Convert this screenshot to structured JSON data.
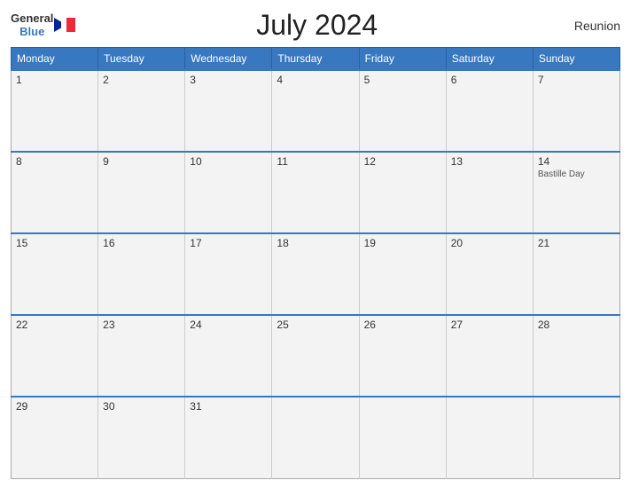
{
  "header": {
    "title": "July 2024",
    "logo_general": "General",
    "logo_blue": "Blue",
    "region": "Reunion"
  },
  "days_of_week": [
    "Monday",
    "Tuesday",
    "Wednesday",
    "Thursday",
    "Friday",
    "Saturday",
    "Sunday"
  ],
  "weeks": [
    [
      {
        "date": "1",
        "event": ""
      },
      {
        "date": "2",
        "event": ""
      },
      {
        "date": "3",
        "event": ""
      },
      {
        "date": "4",
        "event": ""
      },
      {
        "date": "5",
        "event": ""
      },
      {
        "date": "6",
        "event": ""
      },
      {
        "date": "7",
        "event": ""
      }
    ],
    [
      {
        "date": "8",
        "event": ""
      },
      {
        "date": "9",
        "event": ""
      },
      {
        "date": "10",
        "event": ""
      },
      {
        "date": "11",
        "event": ""
      },
      {
        "date": "12",
        "event": ""
      },
      {
        "date": "13",
        "event": ""
      },
      {
        "date": "14",
        "event": "Bastille Day"
      }
    ],
    [
      {
        "date": "15",
        "event": ""
      },
      {
        "date": "16",
        "event": ""
      },
      {
        "date": "17",
        "event": ""
      },
      {
        "date": "18",
        "event": ""
      },
      {
        "date": "19",
        "event": ""
      },
      {
        "date": "20",
        "event": ""
      },
      {
        "date": "21",
        "event": ""
      }
    ],
    [
      {
        "date": "22",
        "event": ""
      },
      {
        "date": "23",
        "event": ""
      },
      {
        "date": "24",
        "event": ""
      },
      {
        "date": "25",
        "event": ""
      },
      {
        "date": "26",
        "event": ""
      },
      {
        "date": "27",
        "event": ""
      },
      {
        "date": "28",
        "event": ""
      }
    ],
    [
      {
        "date": "29",
        "event": ""
      },
      {
        "date": "30",
        "event": ""
      },
      {
        "date": "31",
        "event": ""
      },
      {
        "date": "",
        "event": ""
      },
      {
        "date": "",
        "event": ""
      },
      {
        "date": "",
        "event": ""
      },
      {
        "date": "",
        "event": ""
      }
    ]
  ]
}
